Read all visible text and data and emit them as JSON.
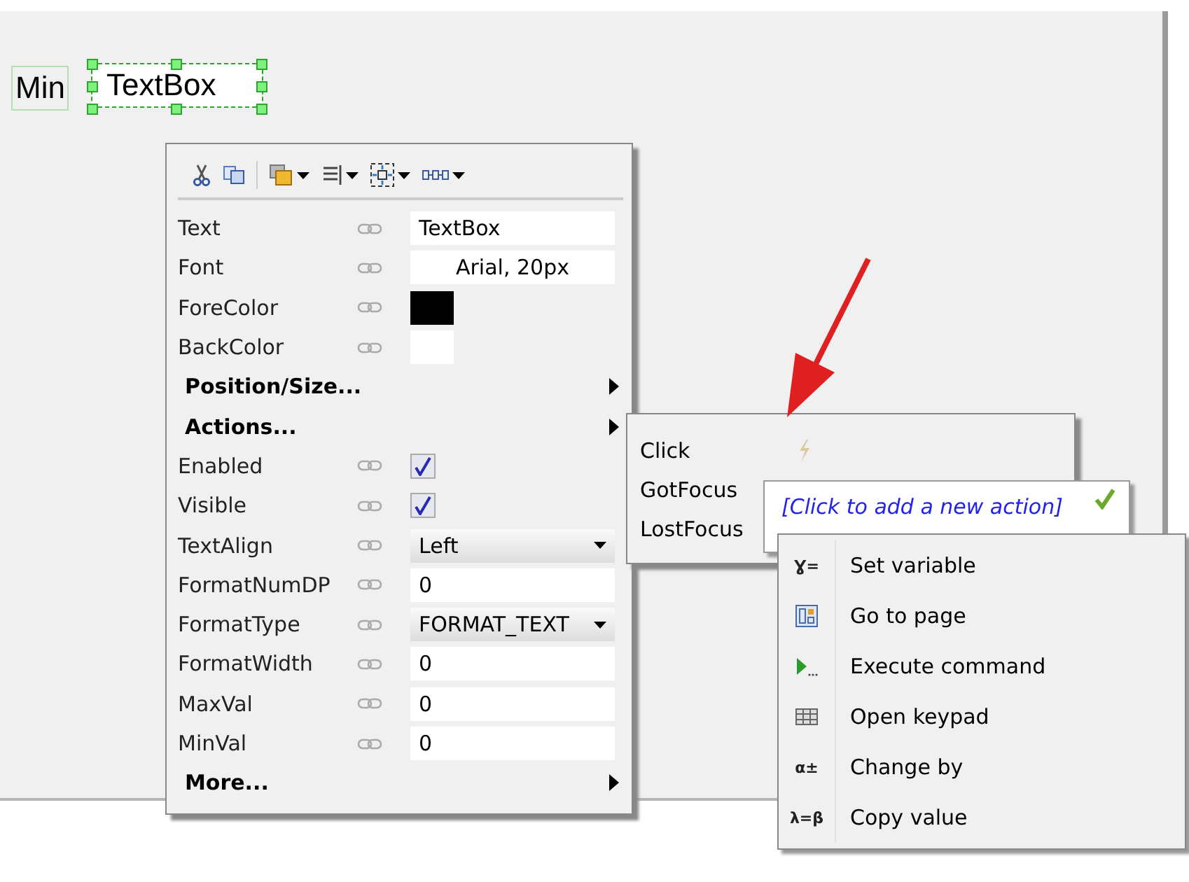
{
  "canvas": {
    "widgets": [
      {
        "kind": "label",
        "text": "Min",
        "selected": false
      },
      {
        "kind": "textbox",
        "text": "TextBox",
        "selected": true
      }
    ]
  },
  "properties": {
    "rows": [
      {
        "kind": "text",
        "label": "Text",
        "value": "TextBox"
      },
      {
        "kind": "centered-text",
        "label": "Font",
        "value": "Arial, 20px"
      },
      {
        "kind": "color",
        "label": "ForeColor",
        "color": "#000000"
      },
      {
        "kind": "color",
        "label": "BackColor",
        "color": "#ffffff"
      },
      {
        "kind": "submenu",
        "label": "Position/Size..."
      },
      {
        "kind": "submenu",
        "label": "Actions..."
      },
      {
        "kind": "check",
        "label": "Enabled",
        "checked": true
      },
      {
        "kind": "check",
        "label": "Visible",
        "checked": true
      },
      {
        "kind": "dropdown",
        "label": "TextAlign",
        "value": "Left"
      },
      {
        "kind": "text",
        "label": "FormatNumDP",
        "value": "0"
      },
      {
        "kind": "dropdown",
        "label": "FormatType",
        "value": "FORMAT_TEXT"
      },
      {
        "kind": "text",
        "label": "FormatWidth",
        "value": "0"
      },
      {
        "kind": "text",
        "label": "MaxVal",
        "value": "0"
      },
      {
        "kind": "text",
        "label": "MinVal",
        "value": "0"
      },
      {
        "kind": "submenu",
        "label": "More..."
      }
    ]
  },
  "events": [
    {
      "label": "Click"
    },
    {
      "label": "GotFocus"
    },
    {
      "label": "LostFocus"
    }
  ],
  "new_action": {
    "label": "[Click to add a new action]"
  },
  "action_menu": [
    {
      "kind": "glyph",
      "glyph": "Ɣ=",
      "label": "Set variable"
    },
    {
      "kind": "page",
      "label": "Go to page"
    },
    {
      "kind": "run",
      "label": "Execute command"
    },
    {
      "kind": "grid",
      "label": "Open keypad"
    },
    {
      "kind": "glyph",
      "glyph": "α±",
      "label": "Change by"
    },
    {
      "kind": "glyph",
      "glyph": "λ=β",
      "label": "Copy value"
    }
  ]
}
